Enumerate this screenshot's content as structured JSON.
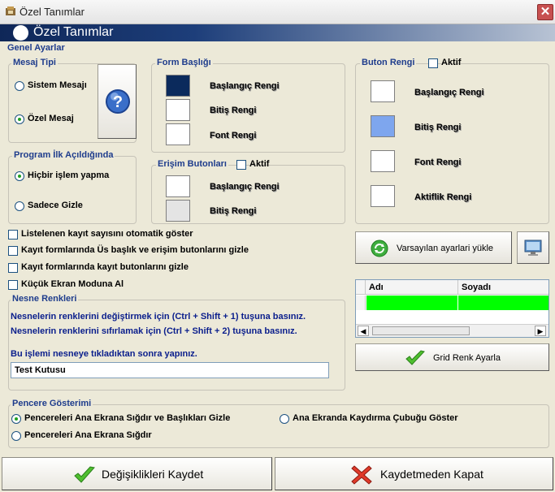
{
  "window": {
    "title": "Özel Tanımlar",
    "close_glyph": "✕"
  },
  "header": {
    "title": "Özel Tanımlar"
  },
  "general": {
    "title": "Genel Ayarlar"
  },
  "mesaj_tipi": {
    "legend": "Mesaj Tipi",
    "options": [
      "Sistem Mesajı",
      "Özel Mesaj"
    ],
    "selected": "Özel Mesaj",
    "help_glyph": "?"
  },
  "form_basligi": {
    "legend": "Form Başlığı",
    "items": [
      "Başlangıç Rengi",
      "Bitiş Rengi",
      "Font Rengi"
    ],
    "colors": [
      "#0b2a5c",
      "#ffffff",
      "#ffffff"
    ]
  },
  "buton_rengi": {
    "legend": "Buton Rengi",
    "aktif_label": "Aktif",
    "aktif_checked": false,
    "items": [
      "Başlangıç Rengi",
      "Bitiş Rengi",
      "Font Rengi",
      "Aktiflik Rengi"
    ],
    "colors": [
      "#ffffff",
      "#7ea6ee",
      "#ffffff",
      "#ffffff"
    ]
  },
  "program_ilk": {
    "legend": "Program İlk Açıldığında",
    "options": [
      "Hiçbir işlem yapma",
      "Sadece Gizle"
    ],
    "selected": "Hiçbir işlem yapma"
  },
  "erisim": {
    "legend": "Erişim Butonları",
    "aktif_label": "Aktif",
    "aktif_checked": false,
    "items": [
      "Başlangıç Rengi",
      "Bitiş Rengi"
    ],
    "colors": [
      "#ffffff",
      "#e4e4e4"
    ]
  },
  "checkboxes": [
    "Listelenen kayıt sayısını otomatik göster",
    "Kayıt formlarında Üs başlık ve erişim butonlarını gizle",
    "Kayıt formlarında kayıt butonlarını gizle",
    "Küçük Ekran Moduna Al"
  ],
  "defaults_button": {
    "label": "Varsayılan ayarlari yükle"
  },
  "nesne": {
    "legend": "Nesne Renkleri",
    "line1": "Nesnelerin renklerini değiştirmek için (Ctrl + Shift + 1) tuşuna basınız.",
    "line2": "Nesnelerin renklerini sıfırlamak için (Ctrl + Shift + 2) tuşuna basınız.",
    "line3": "Bu işlemi nesneye tıkladıktan sonra yapınız.",
    "input_value": "Test Kutusu"
  },
  "grid": {
    "columns": [
      "Adı",
      "Soyadı"
    ],
    "row_color": "#00ff00"
  },
  "grid_button": {
    "label": "Grid Renk Ayarla"
  },
  "pencere": {
    "legend": "Pencere Gösterimi",
    "options": [
      "Pencereleri Ana Ekrana Sığdır ve Başlıkları Gizle",
      "Ana Ekranda Kaydırma Çubuğu Göster",
      "Pencereleri Ana Ekrana Sığdır"
    ],
    "selected": "Pencereleri Ana Ekrana Sığdır ve Başlıkları Gizle"
  },
  "footer": {
    "save": "Değişiklikleri Kaydet",
    "close": "Kaydetmeden Kapat"
  },
  "colors": {
    "accent": "#1e3c8c",
    "header_dark": "#0f2758",
    "check_green": "#21a121",
    "close_red": "#d32f2f"
  }
}
